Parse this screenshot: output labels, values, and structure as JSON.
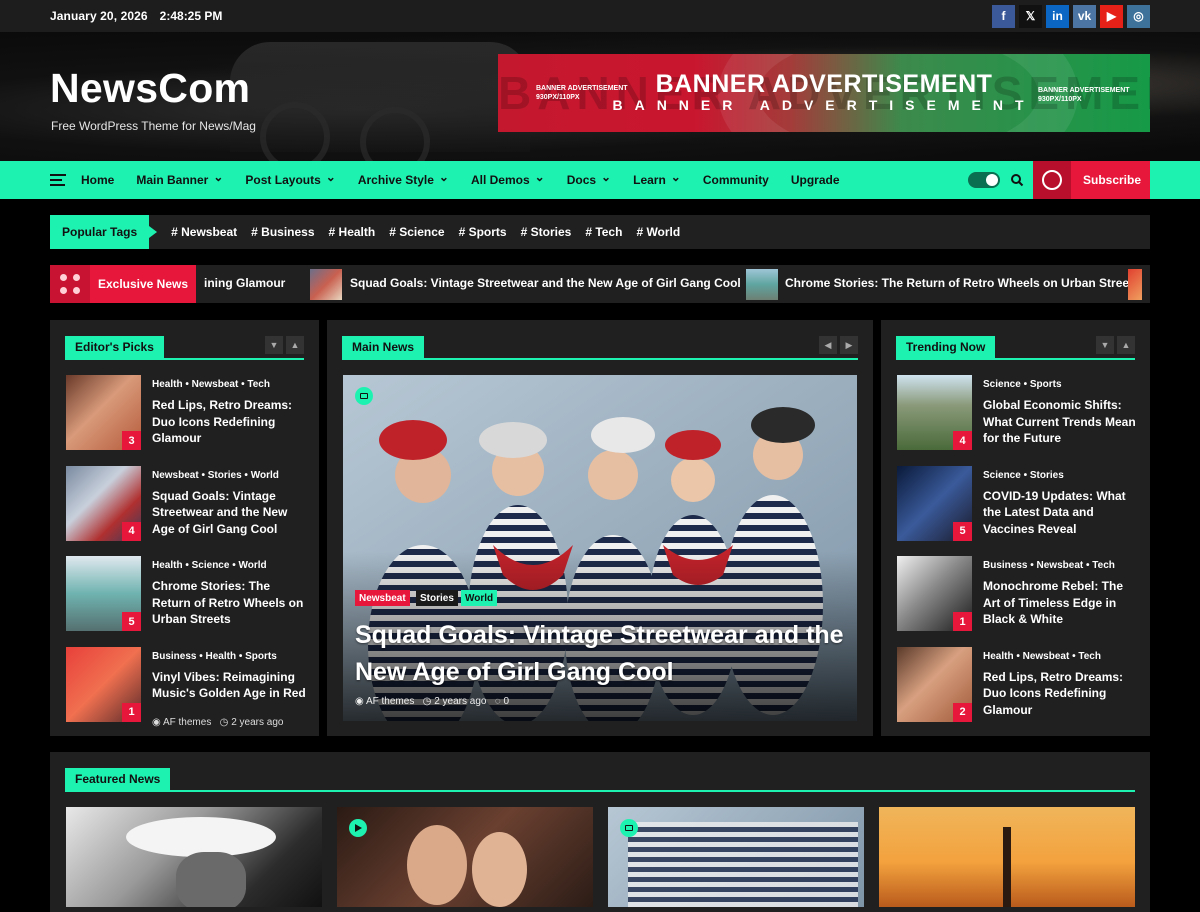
{
  "topbar": {
    "date": "January 20, 2026",
    "time": "2:48:25 PM",
    "social": [
      {
        "icon": "facebook-icon",
        "glyph": "f",
        "color": "#3b5998"
      },
      {
        "icon": "x-twitter-icon",
        "glyph": "𝕏",
        "color": "#111111"
      },
      {
        "icon": "linkedin-icon",
        "glyph": "in",
        "color": "#0a66c2"
      },
      {
        "icon": "vk-icon",
        "glyph": "vk",
        "color": "#4c75a3"
      },
      {
        "icon": "youtube-icon",
        "glyph": "▶",
        "color": "#e62117"
      },
      {
        "icon": "instagram-icon",
        "glyph": "◎",
        "color": "#3f729b"
      }
    ]
  },
  "header": {
    "logo": "NewsCom",
    "tagline": "Free WordPress Theme for News/Mag",
    "banner": {
      "title": "BANNER ADVERTISEMENT",
      "subtitle": "BANNER ADVERTISEMENT",
      "bg_text": "BANNER ADVERTISEMENT",
      "small_left": "BANNER ADVERTISEMENT",
      "small_left_size": "930PX/110PX",
      "small_right": "BANNER ADVERTISEMENT",
      "small_right_size": "930PX/110PX"
    }
  },
  "nav": {
    "items": [
      {
        "label": "Home",
        "dropdown": false
      },
      {
        "label": "Main Banner",
        "dropdown": true
      },
      {
        "label": "Post Layouts",
        "dropdown": true
      },
      {
        "label": "Archive Style",
        "dropdown": true
      },
      {
        "label": "All Demos",
        "dropdown": true
      },
      {
        "label": "Docs",
        "dropdown": true
      },
      {
        "label": "Learn",
        "dropdown": true
      },
      {
        "label": "Community",
        "dropdown": false
      },
      {
        "label": "Upgrade",
        "dropdown": false
      }
    ],
    "subscribe": "Subscribe",
    "accent": "#1ef2b1",
    "red": "#e6173a"
  },
  "tags": {
    "label": "Popular Tags",
    "items": [
      "# Newsbeat",
      "# Business",
      "# Health",
      "# Science",
      "# Sports",
      "# Stories",
      "# Tech",
      "# World"
    ]
  },
  "ticker": {
    "label": "Exclusive News",
    "items": [
      "ining Glamour",
      "Squad Goals: Vintage Streetwear and the New Age of Girl Gang Cool",
      "Chrome Stories: The Return of Retro Wheels on Urban Streets"
    ]
  },
  "editors_picks": {
    "title": "Editor's Picks",
    "stories": [
      {
        "cats": "Health  •  Newsbeat  •  Tech",
        "title": "Red Lips, Retro Dreams: Duo Icons Redefining Glamour",
        "num": "3"
      },
      {
        "cats": "Newsbeat  •  Stories  •  World",
        "title": "Squad Goals: Vintage Streetwear and the New Age of Girl Gang Cool",
        "num": "4"
      },
      {
        "cats": "Health  •  Science  •  World",
        "title": "Chrome Stories: The Return of Retro Wheels on Urban Streets",
        "num": "5"
      },
      {
        "cats": "Business  •  Health  •  Sports",
        "title": "Vinyl Vibes: Reimagining Music's Golden Age in Red",
        "num": "1",
        "author": "AF themes",
        "time": "2 years ago"
      }
    ]
  },
  "main_news": {
    "title": "Main News",
    "badges": [
      "Newsbeat",
      "Stories",
      "World"
    ],
    "headline": "Squad Goals: Vintage Streetwear and the New Age of Girl Gang Cool",
    "author": "AF themes",
    "time": "2 years ago",
    "comments": "0"
  },
  "trending": {
    "title": "Trending Now",
    "stories": [
      {
        "cats": "Science  •  Sports",
        "title": "Global Economic Shifts: What Current Trends Mean for the Future",
        "num": "4"
      },
      {
        "cats": "Science  •  Stories",
        "title": "COVID-19 Updates: What the Latest Data and Vaccines Reveal",
        "num": "5"
      },
      {
        "cats": "Business  •  Newsbeat  •  Tech",
        "title": "Monochrome Rebel: The Art of Timeless Edge in Black & White",
        "num": "1"
      },
      {
        "cats": "Health  •  Newsbeat  •  Tech",
        "title": "Red Lips, Retro Dreams: Duo Icons Redefining Glamour",
        "num": "2"
      }
    ]
  },
  "featured": {
    "title": "Featured News"
  }
}
